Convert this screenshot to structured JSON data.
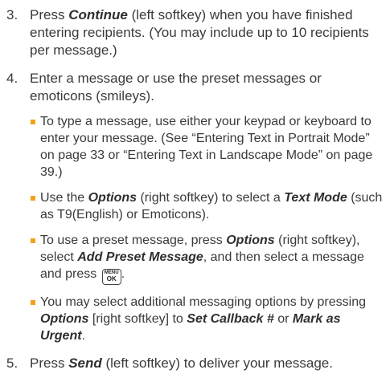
{
  "step3": {
    "num": "3.",
    "t1": "Press ",
    "continue": "Continue",
    "t2": " (left softkey) when you have finished entering recipients. (You may include up to 10 recipients per message.)"
  },
  "step4": {
    "num": "4.",
    "text": "Enter a message or use the preset messages or emoticons (smileys).",
    "b1": "To type a message, use either your keypad or keyboard to enter your message. (See “Entering Text in Portrait Mode” on page 33 or “Entering Text in Landscape Mode” on page 39.)",
    "b2": {
      "t1": "Use the ",
      "options": "Options",
      "t2": " (right softkey) to select a ",
      "textmode": "Text Mode",
      "t3": " (such as T9(English) or Emoticons)."
    },
    "b3": {
      "t1": "To use a preset message, press ",
      "options": "Options",
      "t2": " (right softkey), select ",
      "addpreset": "Add Preset Message",
      "t3": ", and then select a message and press ",
      "key_top": "MENU",
      "key_bottom": "OK",
      "t4": "."
    },
    "b4": {
      "t1": "You may select additional messaging options by pressing ",
      "options": "Options",
      "t2": " [right softkey] to ",
      "callback": "Set Callback #",
      "t3": " or ",
      "urgent": "Mark as Urgent",
      "t4": "."
    }
  },
  "step5": {
    "num": "5.",
    "t1": "Press ",
    "send": "Send",
    "t2": " (left softkey) to deliver your message."
  },
  "colors": {
    "bullet": "#f1a21b",
    "text": "#3a3a3a"
  }
}
